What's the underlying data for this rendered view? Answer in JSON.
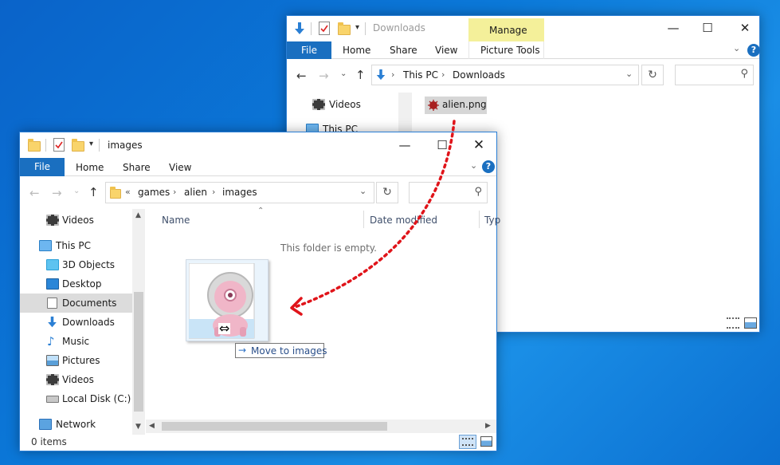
{
  "back_window": {
    "title": "Downloads",
    "contextual_tab": "Manage",
    "contextual_tab_color": "#f4f09a",
    "tabs": {
      "file": "File",
      "home": "Home",
      "share": "Share",
      "view": "View",
      "picture_tools": "Picture Tools"
    },
    "breadcrumb": [
      "This PC",
      "Downloads"
    ],
    "nav": {
      "videos": "Videos",
      "this_pc": "This PC"
    },
    "file": {
      "name": "alien.png"
    }
  },
  "front_window": {
    "title": "images",
    "tabs": {
      "file": "File",
      "home": "Home",
      "share": "Share",
      "view": "View"
    },
    "breadcrumb": {
      "overflow": "«",
      "items": [
        "games",
        "alien",
        "images"
      ]
    },
    "nav": {
      "videos_top": "Videos",
      "this_pc": "This PC",
      "objects": "3D Objects",
      "desktop": "Desktop",
      "documents": "Documents",
      "downloads": "Downloads",
      "music": "Music",
      "pictures": "Pictures",
      "videos": "Videos",
      "local_disk": "Local Disk (C:)",
      "network": "Network"
    },
    "columns": {
      "name": "Name",
      "date_modified": "Date modified",
      "type": "Typ"
    },
    "empty_message": "This folder is empty.",
    "status": "0 items"
  },
  "drag": {
    "tooltip": "Move to images",
    "arrow_color": "#e0141a"
  },
  "colors": {
    "accent": "#1a6fc0",
    "desktop": "#0b78d8",
    "selection": "#dcdcdc"
  }
}
